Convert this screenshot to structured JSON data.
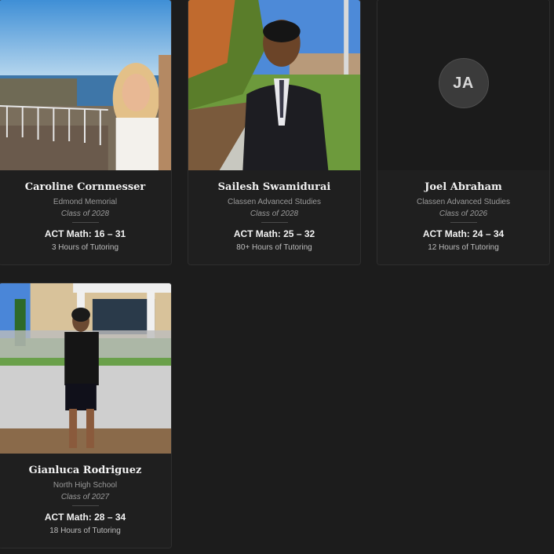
{
  "tutors": [
    {
      "name": "Caroline Cornmesser",
      "school": "Edmond Memorial",
      "class_year": "Class of 2028",
      "act": "ACT Math: 16 – 31",
      "hours": "3 Hours of Tutoring"
    },
    {
      "name": "Sailesh Swamidurai",
      "school": "Classen Advanced Studies",
      "class_year": "Class of 2028",
      "act": "ACT Math: 25 – 32",
      "hours": "80+ Hours of Tutoring"
    },
    {
      "name": "Joel Abraham",
      "school": "Classen Advanced Studies",
      "class_year": "Class of 2026",
      "act": "ACT Math: 24 – 34",
      "hours": "12 Hours of Tutoring",
      "initials": "JA"
    },
    {
      "name": "Gianluca Rodriguez",
      "school": "North High School",
      "class_year": "Class of 2027",
      "act": "ACT Math: 28 – 34",
      "hours": "18 Hours of Tutoring"
    }
  ]
}
